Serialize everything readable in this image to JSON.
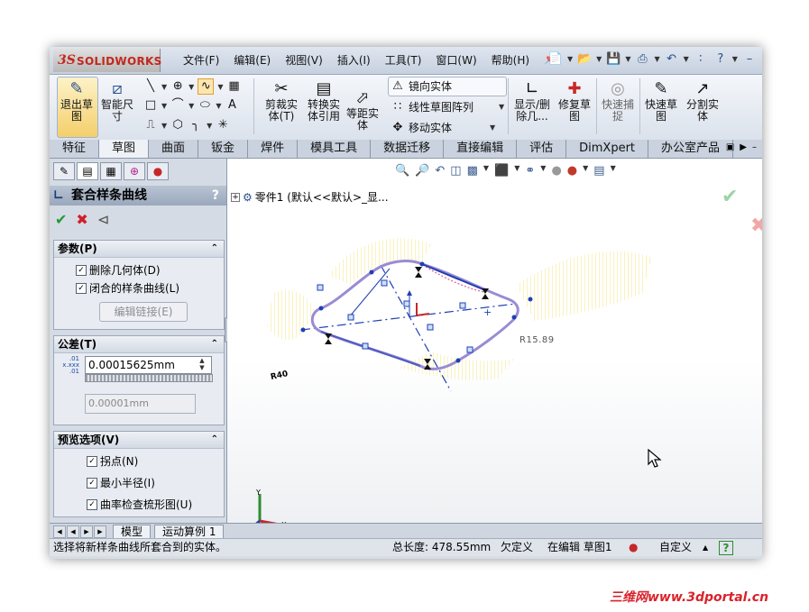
{
  "app": {
    "logo_prefix": "3S",
    "logo_name": "SOLIDWORKS",
    "menu": [
      "文件(F)",
      "编辑(E)",
      "视图(V)",
      "插入(I)",
      "工具(T)",
      "窗口(W)",
      "帮助(H)"
    ],
    "quick_access": [
      "new-icon",
      "open-icon",
      "save-icon",
      "print-icon",
      "undo-icon",
      "select-icon",
      "help-icon"
    ],
    "quick_labels": [
      "?"
    ]
  },
  "ribbon": {
    "exit_sketch": "退出草图",
    "smart_dim": "智能尺寸",
    "trim": "剪裁实体(T)",
    "convert": "转换实体引用",
    "offset": "等距实体",
    "mirror": "镜向实体",
    "linear_pattern": "线性草图阵列",
    "move": "移动实体",
    "show_delete": "显示/删除几...",
    "repair": "修复草图",
    "quick_snap": "快速捕捉",
    "rapid_sketch": "快速草图",
    "split": "分割实体"
  },
  "tabs": [
    "特征",
    "草图",
    "曲面",
    "钣金",
    "焊件",
    "模具工具",
    "数据迁移",
    "直接编辑",
    "评估",
    "DimXpert",
    "办公室产品"
  ],
  "active_tab": "草图",
  "property_manager": {
    "title": "套合样条曲线",
    "help": "?",
    "params": {
      "header": "参数(P)",
      "delete_geometry": "删除几何体(D)",
      "closed_spline": "闭合的样条曲线(L)",
      "edit_link": "编辑链接(E)"
    },
    "tolerance": {
      "header": "公差(T)",
      "icon_label_top": ".01",
      "icon_label_mid": "x.xxx",
      "icon_label_bot": ".01",
      "value": "0.00015625mm",
      "value2": "0.00001mm"
    },
    "preview": {
      "header": "预览选项(V)",
      "inflection": "拐点(N)",
      "min_radius": "最小半径(I)",
      "curvature_comb": "曲率检查梳形图(U)"
    }
  },
  "graphics": {
    "tree_label": "零件1 (默认<<默认>_显...",
    "dim_r40": "R40",
    "dim_r15": "R15.89",
    "triad_x": "X",
    "triad_y": "Y",
    "triad_z": "Z"
  },
  "bottom_tabs": [
    "模型",
    "运动算例 1"
  ],
  "status": {
    "message": "选择将新样条曲线所套合到的实体。",
    "length": "总长度: 478.55mm",
    "constraint": "欠定义",
    "editing": "在编辑 草图1",
    "custom": "自定义",
    "help": "?"
  },
  "watermark": "三维网www.3dportal.cn"
}
